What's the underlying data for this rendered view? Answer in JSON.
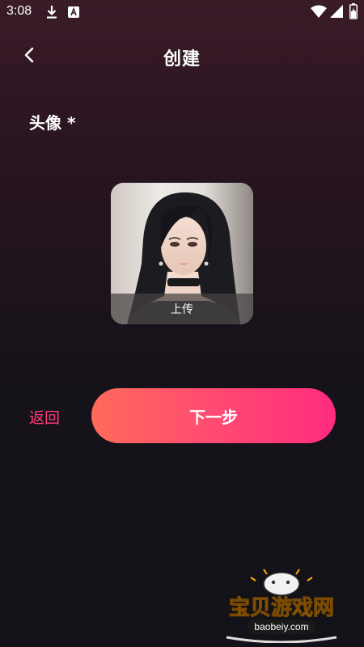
{
  "status_bar": {
    "time": "3:08",
    "icons": [
      "download-icon",
      "app-notification-icon",
      "wifi-icon",
      "signal-icon",
      "battery-icon"
    ]
  },
  "header": {
    "back_icon": "chevron-left-icon",
    "title": "创建"
  },
  "form": {
    "avatar_label": "头像 *",
    "upload_label": "上传"
  },
  "actions": {
    "return_label": "返回",
    "next_label": "下一步"
  },
  "watermark": {
    "brand_text": "宝贝游戏网",
    "url_text": "baobeiy.com"
  },
  "colors": {
    "accent_pink": "#ff3b78",
    "button_gradient_start": "#ff6a5a",
    "button_gradient_end": "#ff2c7e",
    "background_top": "#3a1b28",
    "background_bottom": "#121218"
  }
}
